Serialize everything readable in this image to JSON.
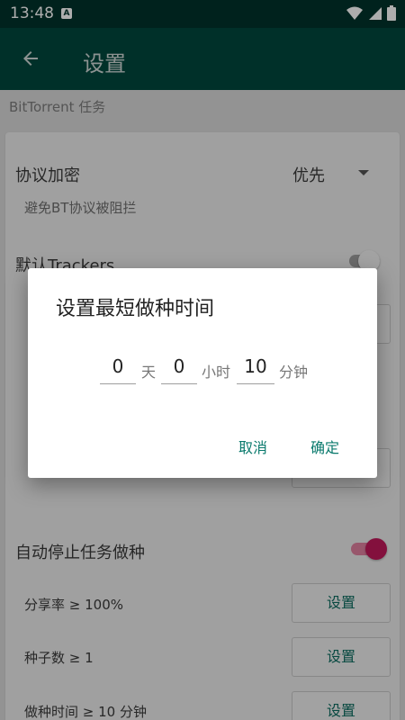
{
  "status_bar": {
    "time": "13:48",
    "badge": "A"
  },
  "app_bar": {
    "title": "设置"
  },
  "section": {
    "label": "BitTorrent 任务"
  },
  "settings": {
    "encryption": {
      "title": "协议加密",
      "value": "优先",
      "subtitle": "避免BT协议被阻拦"
    },
    "default_trackers": {
      "title": "默认Trackers"
    },
    "auto_stop": {
      "title": "自动停止任务做种"
    },
    "share_ratio": {
      "label": "分享率 ≥ 100%",
      "button": "设置"
    },
    "seed_count": {
      "label": "种子数 ≥ 1",
      "button": "设置"
    },
    "seed_time": {
      "label": "做种时间 ≥ 10 分钟",
      "button": "设置"
    }
  },
  "dialog": {
    "title": "设置最短做种时间",
    "days": {
      "value": "0",
      "unit": "天"
    },
    "hours": {
      "value": "0",
      "unit": "小时"
    },
    "minutes": {
      "value": "10",
      "unit": "分钟"
    },
    "cancel": "取消",
    "confirm": "确定"
  },
  "colors": {
    "status_bar": "#00332b",
    "app_bar": "#00473d",
    "accent": "#0a7a6d",
    "switch_on": "#c2185b"
  },
  "icons": {
    "back": "arrow-left-icon",
    "dropdown": "triangle-down-icon",
    "wifi": "wifi-icon",
    "signal": "cell-signal-icon",
    "battery": "battery-icon"
  }
}
